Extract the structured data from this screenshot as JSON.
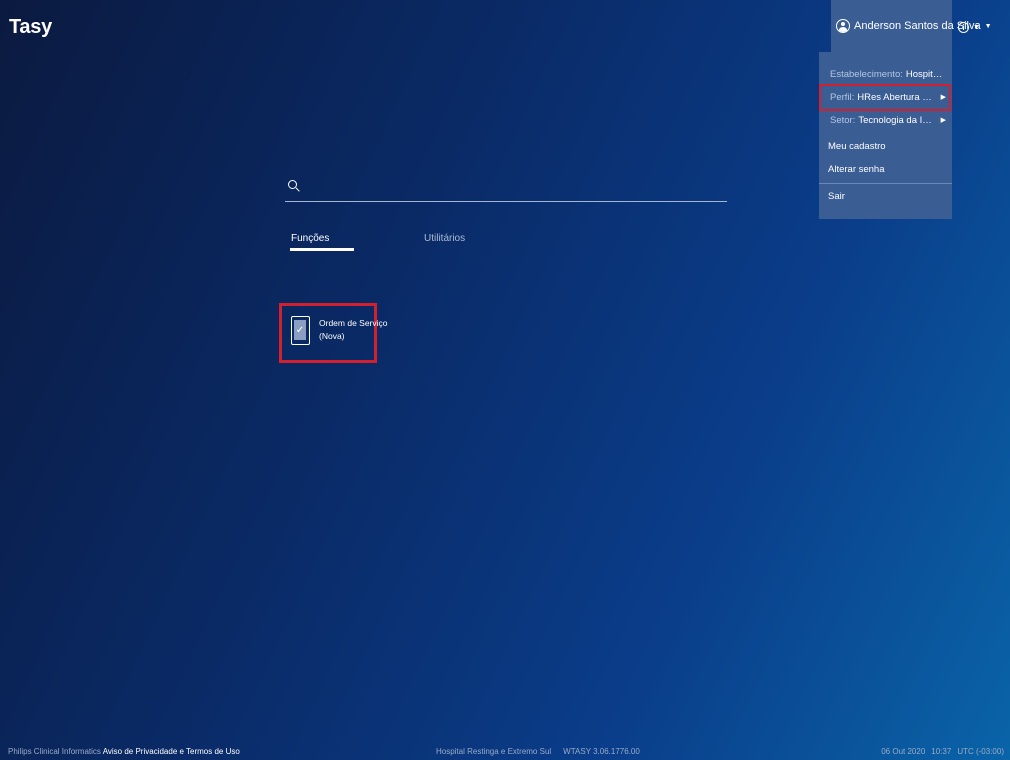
{
  "app": {
    "title": "Tasy"
  },
  "user": {
    "name": "Anderson Santos da Silva"
  },
  "user_menu": {
    "establishment_label": "Estabelecimento:",
    "establishment_value": "Hospital Resting...",
    "profile_label": "Perfil:",
    "profile_value": "HRes Abertura de Ordem ...",
    "sector_label": "Setor:",
    "sector_value": "Tecnologia da Informação",
    "my_registration": "Meu cadastro",
    "change_password": "Alterar senha",
    "logout": "Sair"
  },
  "search": {
    "placeholder": "",
    "value": ""
  },
  "tabs": [
    {
      "label": "Funções",
      "active": true
    },
    {
      "label": "Utilitários",
      "active": false
    }
  ],
  "functions": [
    {
      "label_line1": "Ordem de Serviço",
      "label_line2": "(Nova)",
      "icon": "checklist-icon"
    }
  ],
  "footer": {
    "company": "Philips Clinical Informatics",
    "privacy": "Aviso de Privacidade e Termos de Uso",
    "hospital": "Hospital Restinga e Extremo Sul",
    "version": "WTASY 3.06.1776.00",
    "date": "06 Out 2020",
    "time": "10:37",
    "timezone": "UTC (-03:00)"
  },
  "colors": {
    "accent_highlight": "#d3202f",
    "menu_bg": "#3a5d94"
  }
}
